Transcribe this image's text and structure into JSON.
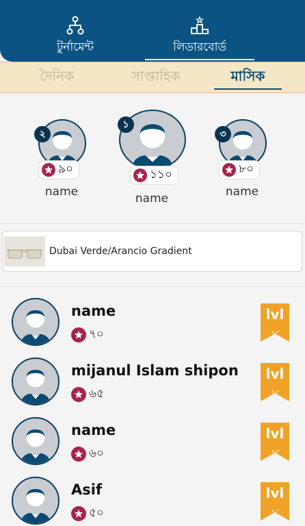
{
  "top_tabs": {
    "tournament_label": "টুর্নামেন্ট",
    "leaderboard_label": "লিডারবোর্ড",
    "active": "leaderboard"
  },
  "period_tabs": {
    "daily": "দৈনিক",
    "weekly": "সাপ্তাহিক",
    "monthly": "মাসিক",
    "active": "monthly"
  },
  "podium": [
    {
      "rank": "২",
      "score": "৯০",
      "name": "name"
    },
    {
      "rank": "১",
      "score": "১১০",
      "name": "name"
    },
    {
      "rank": "৩",
      "score": "৮০",
      "name": "name"
    }
  ],
  "ad": {
    "title": "Dubai Verde/Arancio Gradient"
  },
  "leaderboard": [
    {
      "name": "name",
      "score": "৭০",
      "level_label": "lvl",
      "level": "১"
    },
    {
      "name": "mijanul Islam shipon",
      "score": "৬৫",
      "level_label": "lvl",
      "level": "১"
    },
    {
      "name": "name",
      "score": "৬০",
      "level_label": "lvl",
      "level": "১"
    },
    {
      "name": "Asif",
      "score": "৫০",
      "level_label": "lvl",
      "level": "১"
    }
  ],
  "colors": {
    "header": "#0b5383",
    "tab_bar": "#f4e7c6",
    "star": "#a8234e",
    "level_badge": "#f0a226"
  }
}
